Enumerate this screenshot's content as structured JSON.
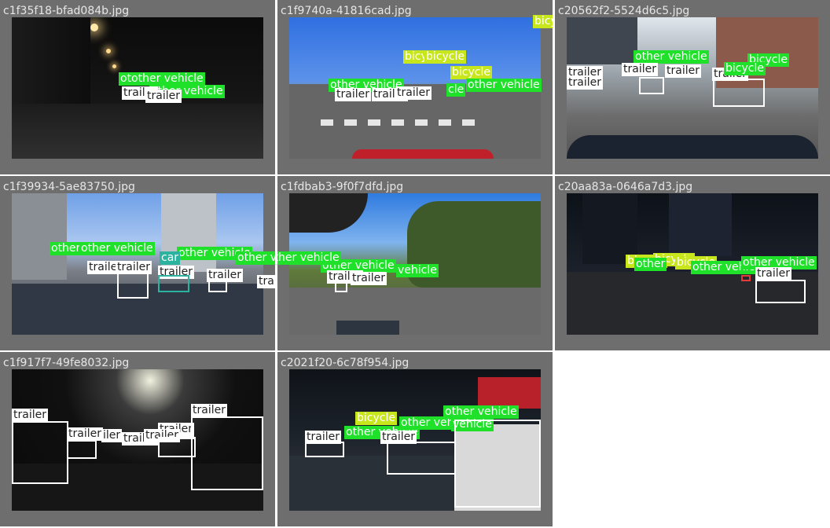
{
  "grid": {
    "cells": [
      {
        "title": "c1f35f18-bfad084b.jpg",
        "labels": [
          "otother vehicle",
          "other vehicle",
          "trailer",
          "trailer"
        ]
      },
      {
        "title": "c1f9740a-41816cad.jpg",
        "labels": [
          "bicycle",
          "bicycle",
          "bicycle",
          "bicycle",
          "other vehicle",
          "other vehicle",
          "trailer",
          "trailer",
          "trailer",
          "cle"
        ]
      },
      {
        "title": "c20562f2-5524d6c5.jpg",
        "labels": [
          "other vehicle",
          "bicycle",
          "trailer",
          "trailer",
          "trailer",
          "trailer",
          "trailer",
          "bicycle"
        ]
      },
      {
        "title": "c1f39934-5ae83750.jpg",
        "labels": [
          "other",
          "other vehicle",
          "other vehicle",
          "other vehicle",
          "car",
          "trailer",
          "trailer",
          "trailer",
          "trailer",
          "trailer"
        ]
      },
      {
        "title": "c1fdbab3-9f0f7dfd.jpg",
        "labels": [
          "other vehicle",
          "other vehicle",
          "trailer",
          "trailer",
          "vehicle"
        ]
      },
      {
        "title": "c20aa83a-0646a7d3.jpg",
        "labels": [
          "bicycle",
          "bicycle",
          "bicycle",
          "other vehicle",
          "other vehicle",
          "trailer",
          "other"
        ]
      },
      {
        "title": "c1f917f7-49fe8032.jpg",
        "labels": [
          "trailer",
          "trailer",
          "trailer",
          "trailer",
          "trailer",
          "trailer",
          "trailer",
          "iler"
        ]
      },
      {
        "title": "c2021f20-6c78f954.jpg",
        "labels": [
          "bicycle",
          "other vehicle",
          "other vehicle",
          "trailer",
          "trailer",
          "trailer",
          "vehicle",
          "other vehicle"
        ]
      }
    ]
  },
  "colors": {
    "panel_bg": "#6e6e6e",
    "label_green": "#1fe12a",
    "label_lime": "#c8e61c",
    "label_white": "#ffffff",
    "label_teal": "#2bb3a0",
    "box_white": "#ffffff"
  }
}
